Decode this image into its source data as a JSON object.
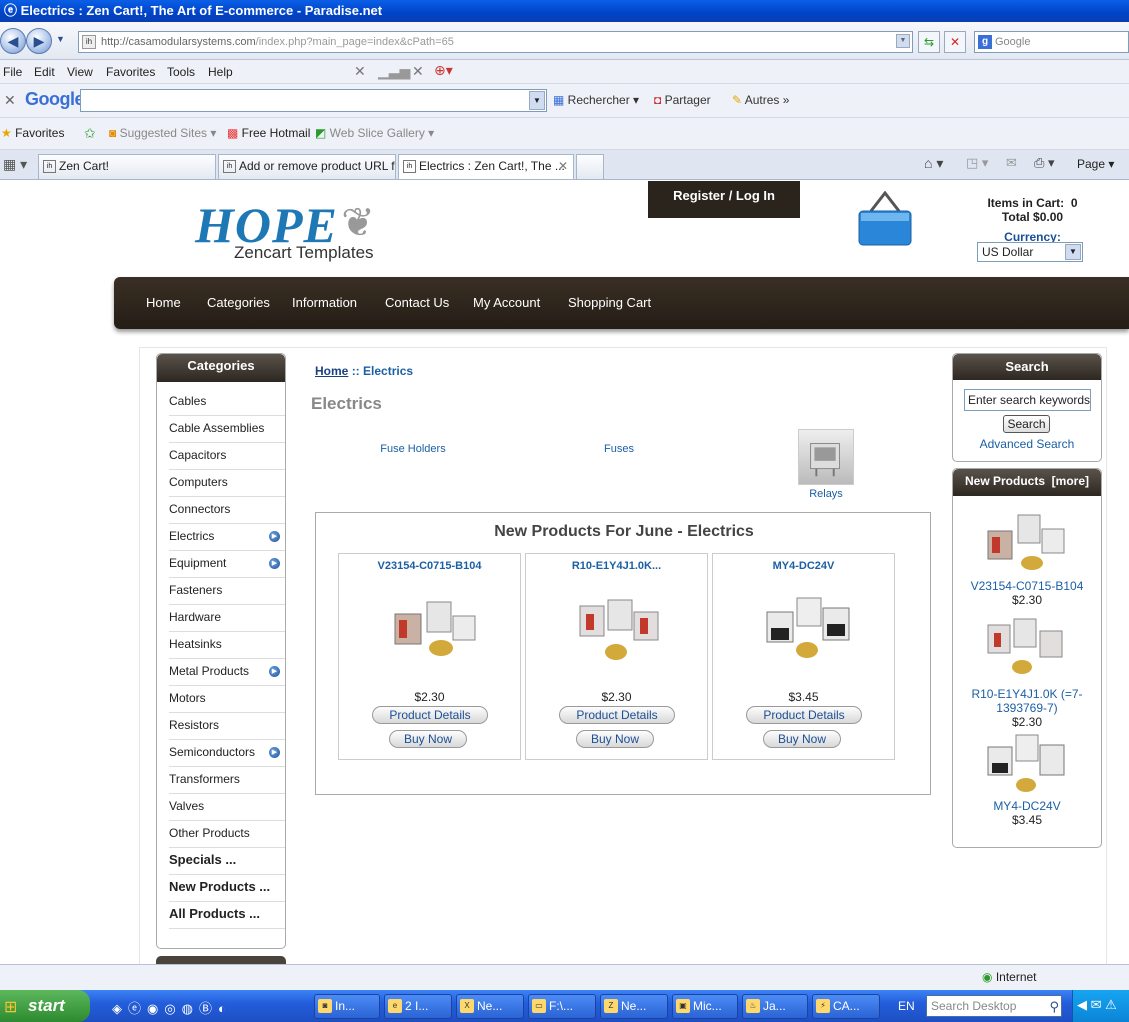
{
  "window": {
    "title": "Electrics : Zen Cart!, The Art of E-commerce - Paradise.net"
  },
  "browser": {
    "address": "http://casamodularsystems.com/index.php?main_page=index&cPath=65",
    "address_host": "http://casamodularsystems.com",
    "address_path": "/index.php?main_page=index&cPath=65",
    "search_placeholder": "Google",
    "menu": [
      "File",
      "Edit",
      "View",
      "Favorites",
      "Tools",
      "Help"
    ],
    "googlebar": {
      "logo": "Google",
      "search_label": "Rechercher",
      "share_label": "Partager",
      "others_label": "Autres"
    },
    "favorites": {
      "label": "Favorites",
      "items": [
        "Suggested Sites",
        "Free Hotmail",
        "Web Slice Gallery"
      ]
    },
    "tabs": [
      "Zen Cart!",
      "Add or remove product URL f...",
      "Electrics : Zen Cart!, The ..."
    ],
    "tools": {
      "page": "Page"
    },
    "status_zone": "Internet"
  },
  "site": {
    "logo": "HOPE",
    "logo_sub": "Zencart Templates",
    "register": "Register  / Log In",
    "cart_items_label": "Items in Cart:",
    "cart_items": "0",
    "cart_total": "Total $0.00",
    "currency_label": "Currency:",
    "currency_value": "US Dollar",
    "nav": [
      "Home",
      "Categories",
      "Information",
      "Contact Us",
      "My Account",
      "Shopping Cart"
    ]
  },
  "categories": {
    "title": "Categories",
    "items": [
      {
        "label": "Cables",
        "sub": false
      },
      {
        "label": "Cable Assemblies",
        "sub": false
      },
      {
        "label": "Capacitors",
        "sub": false
      },
      {
        "label": "Computers",
        "sub": false
      },
      {
        "label": "Connectors",
        "sub": false
      },
      {
        "label": "Electrics",
        "sub": true
      },
      {
        "label": "Equipment",
        "sub": true
      },
      {
        "label": "Fasteners",
        "sub": false
      },
      {
        "label": "Hardware",
        "sub": false
      },
      {
        "label": "Heatsinks",
        "sub": false
      },
      {
        "label": "Metal Products",
        "sub": true
      },
      {
        "label": "Motors",
        "sub": false
      },
      {
        "label": "Resistors",
        "sub": false
      },
      {
        "label": "Semiconductors",
        "sub": true
      },
      {
        "label": "Transformers",
        "sub": false
      },
      {
        "label": "Valves",
        "sub": false
      },
      {
        "label": "Other Products",
        "sub": false
      }
    ],
    "specials": [
      "Specials ...",
      "New Products ...",
      "All Products ..."
    ]
  },
  "main": {
    "breadcrumb_home": "Home",
    "breadcrumb_sep": "::",
    "breadcrumb_current": "Electrics",
    "title": "Electrics",
    "subcategories": [
      "Fuse Holders",
      "Fuses",
      "Relays"
    ],
    "new_products_title": "New Products For June - Electrics",
    "products": [
      {
        "name": "V23154-C0715-B104",
        "price": "$2.30",
        "details": "Product Details",
        "buy": "Buy Now"
      },
      {
        "name": "R10-E1Y4J1.0K...",
        "price": "$2.30",
        "details": "Product Details",
        "buy": "Buy Now"
      },
      {
        "name": "MY4-DC24V",
        "price": "$3.45",
        "details": "Product Details",
        "buy": "Buy Now"
      }
    ]
  },
  "sidebar_right": {
    "search_title": "Search",
    "search_value": "Enter search keywords",
    "search_button": "Search",
    "advanced": "Advanced Search",
    "new_title": "New Products",
    "new_more": "[more]",
    "products": [
      {
        "name": "V23154-C0715-B104",
        "price": "$2.30"
      },
      {
        "name": "R10-E1Y4J1.0K (=7-1393769-7)",
        "price": "$2.30"
      },
      {
        "name": "MY4-DC24V",
        "price": "$3.45"
      }
    ]
  },
  "taskbar": {
    "start": "start",
    "items": [
      "In...",
      "2 I...",
      "Ne...",
      "F:\\...",
      "Ne...",
      "Mic...",
      "Ja...",
      "CA..."
    ],
    "lang": "EN",
    "search_placeholder": "Search Desktop"
  }
}
